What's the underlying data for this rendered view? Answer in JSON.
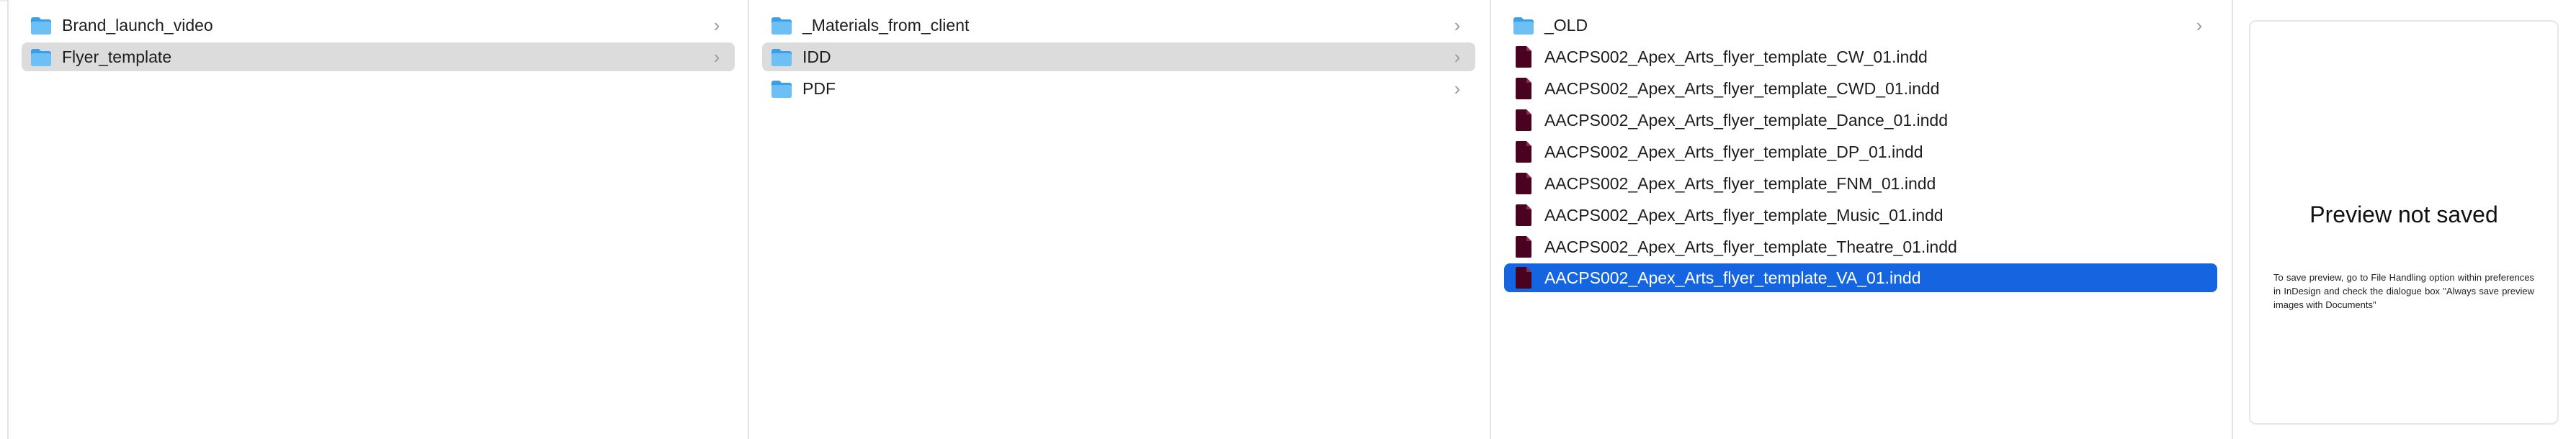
{
  "columns": {
    "col1": {
      "items": [
        {
          "label": "Brand_launch_video",
          "icon": "folder-icon"
        },
        {
          "label": "Flyer_template",
          "icon": "folder-icon"
        }
      ]
    },
    "col2": {
      "items": [
        {
          "label": "_Materials_from_client",
          "icon": "folder-icon"
        },
        {
          "label": "IDD",
          "icon": "folder-icon"
        },
        {
          "label": "PDF",
          "icon": "folder-icon"
        }
      ]
    },
    "col3": {
      "items": [
        {
          "label": "_OLD",
          "icon": "folder-icon"
        },
        {
          "label": "AACPS002_Apex_Arts_flyer_template_CW_01.indd",
          "icon": "indesign-file-icon"
        },
        {
          "label": "AACPS002_Apex_Arts_flyer_template_CWD_01.indd",
          "icon": "indesign-file-icon"
        },
        {
          "label": "AACPS002_Apex_Arts_flyer_template_Dance_01.indd",
          "icon": "indesign-file-icon"
        },
        {
          "label": "AACPS002_Apex_Arts_flyer_template_DP_01.indd",
          "icon": "indesign-file-icon"
        },
        {
          "label": "AACPS002_Apex_Arts_flyer_template_FNM_01.indd",
          "icon": "indesign-file-icon"
        },
        {
          "label": "AACPS002_Apex_Arts_flyer_template_Music_01.indd",
          "icon": "indesign-file-icon"
        },
        {
          "label": "AACPS002_Apex_Arts_flyer_template_Theatre_01.indd",
          "icon": "indesign-file-icon"
        },
        {
          "label": "AACPS002_Apex_Arts_flyer_template_VA_01.indd",
          "icon": "indesign-file-icon"
        }
      ]
    }
  },
  "file_badge": "Id",
  "chevron": "›",
  "preview": {
    "title": "Preview not saved",
    "message": "To save preview, go to File Handling option within preferences in InDesign and check the dialogue box \"Always save preview images with Documents\""
  },
  "colors": {
    "selection_active": "#1565e0",
    "selection_inactive": "#dcdcdc",
    "folder": "#5ab4f0",
    "indesign": "#49021f"
  }
}
